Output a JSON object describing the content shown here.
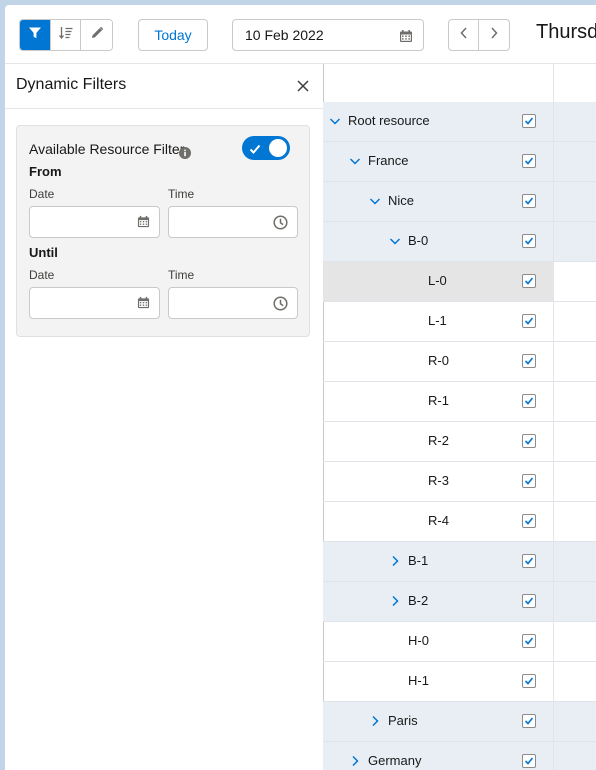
{
  "toolbar": {
    "today_label": "Today",
    "date_value": "10 Feb 2022",
    "day_title": "Thursd",
    "icons": [
      "filter-icon",
      "sort-icon",
      "pencil-icon",
      "calendar-icon",
      "chevron-left-icon",
      "chevron-right-icon"
    ],
    "active_color": "#0176d3"
  },
  "filter_panel": {
    "title": "Dynamic Filters",
    "available_label": "Available Resource Filter",
    "available_enabled": true,
    "from_label": "From",
    "until_label": "Until",
    "date_label": "Date",
    "time_label": "Time"
  },
  "resources": [
    {
      "label": "Root resource",
      "expanded": true,
      "checked": true
    },
    {
      "label": "France",
      "expanded": true,
      "checked": true
    },
    {
      "label": "Nice",
      "expanded": true,
      "checked": true
    },
    {
      "label": "B-0",
      "expanded": true,
      "checked": true
    },
    {
      "label": "L-0",
      "checked": true,
      "selected": true
    },
    {
      "label": "L-1",
      "checked": true
    },
    {
      "label": "R-0",
      "checked": true
    },
    {
      "label": "R-1",
      "checked": true
    },
    {
      "label": "R-2",
      "checked": true
    },
    {
      "label": "R-3",
      "checked": true
    },
    {
      "label": "R-4",
      "checked": true
    },
    {
      "label": "B-1",
      "expanded": false,
      "checked": true
    },
    {
      "label": "B-2",
      "expanded": false,
      "checked": true
    },
    {
      "label": "H-0",
      "checked": true
    },
    {
      "label": "H-1",
      "checked": true
    },
    {
      "label": "Paris",
      "expanded": false,
      "checked": true
    },
    {
      "label": "Germany",
      "expanded": false,
      "checked": true
    }
  ]
}
